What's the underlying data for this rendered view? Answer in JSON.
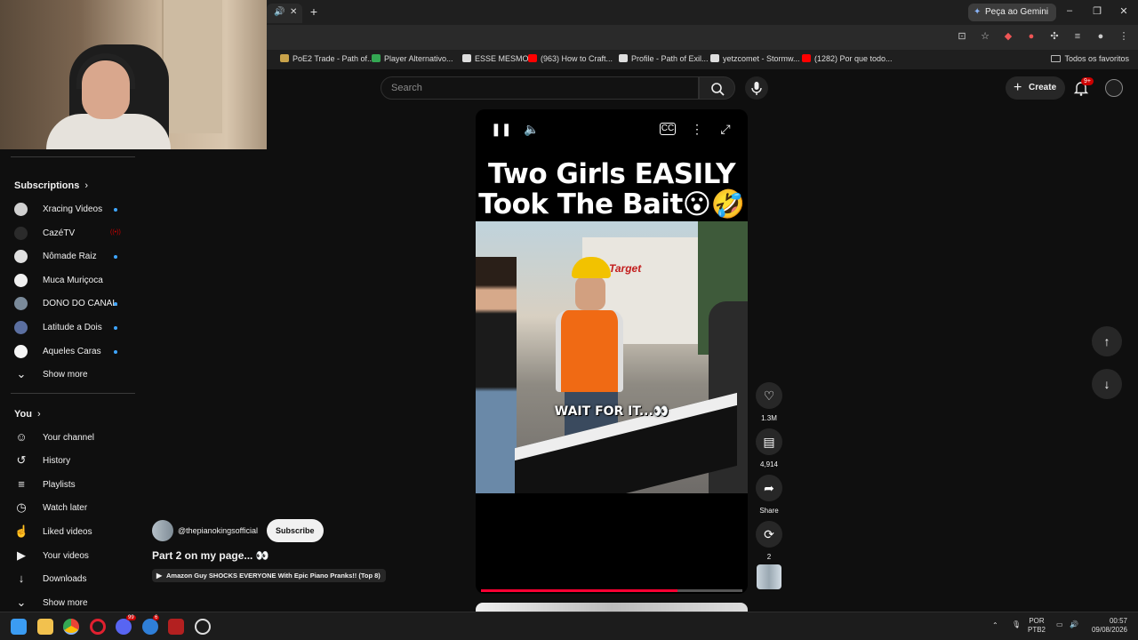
{
  "browser": {
    "gemini_label": "Peça ao Gemini",
    "bookmarks": [
      {
        "label": "PoE2 Trade - Path of...",
        "color": "#c8a24a"
      },
      {
        "label": "Player Alternativo...",
        "color": "#34a853"
      },
      {
        "label": "ESSE MESMO",
        "color": "#dddddd"
      },
      {
        "label": "(963) How to Craft...",
        "color": "#ff0000"
      },
      {
        "label": "Profile - Path of Exil...",
        "color": "#dddddd"
      },
      {
        "label": "yetzcomet - Stormw...",
        "color": "#dddddd"
      },
      {
        "label": "(1282) Por que todo...",
        "color": "#ff0000"
      }
    ],
    "all_favorites": "Todos os favoritos"
  },
  "youtube": {
    "search_placeholder": "Search",
    "create_label": "Create",
    "notifications_badge": "9+"
  },
  "sidebar": {
    "subscriptions_title": "Subscriptions",
    "subscriptions": [
      {
        "label": "Xracing Videos",
        "indicator": "dot",
        "color": "#d0d0d0"
      },
      {
        "label": "CazéTV",
        "indicator": "live",
        "color": "#2b2b2b"
      },
      {
        "label": "Nômade Raiz",
        "indicator": "dot",
        "color": "#e0e0e0"
      },
      {
        "label": "Muca Muriçoca",
        "indicator": "none",
        "color": "#f0f0f0"
      },
      {
        "label": "DONO DO CANAL",
        "indicator": "dot",
        "color": "#7a8a9a"
      },
      {
        "label": "Latitude a Dois",
        "indicator": "dot",
        "color": "#5b6fa0"
      },
      {
        "label": "Aqueles Caras",
        "indicator": "dot",
        "color": "#f5f5f5"
      }
    ],
    "show_more_1": "Show more",
    "you_title": "You",
    "you_items": [
      {
        "label": "Your channel",
        "icon": "person-icon",
        "glyph": "☺"
      },
      {
        "label": "History",
        "icon": "history-icon",
        "glyph": "↺"
      },
      {
        "label": "Playlists",
        "icon": "playlist-icon",
        "glyph": "≡"
      },
      {
        "label": "Watch later",
        "icon": "clock-icon",
        "glyph": "◷"
      },
      {
        "label": "Liked videos",
        "icon": "thumbs-up-icon",
        "glyph": "☝"
      },
      {
        "label": "Your videos",
        "icon": "video-icon",
        "glyph": "▶"
      },
      {
        "label": "Downloads",
        "icon": "download-icon",
        "glyph": "↓"
      }
    ],
    "show_more_2": "Show more"
  },
  "short": {
    "title_line1": "Two Girls EASILY",
    "title_line2": "Took The Bait😮🤣",
    "caption": "WAIT FOR IT...👀",
    "progress": 0.75,
    "channel": "@thepianokingsofficial",
    "subscribe_label": "Subscribe",
    "description": "Part 2 on my page... 👀",
    "link_chip": "Amazon Guy SHOCKS EVERYONE With Epic Piano Pranks!! (Top 8)",
    "likes": "1.3M",
    "comments": "4,914",
    "share_label": "Share",
    "remix_count": "2"
  },
  "taskbar": {
    "lang_line1": "POR",
    "lang_line2": "PTB2",
    "time": "00:57",
    "date": "09/08/2026",
    "badges": {
      "discord": "99",
      "edge": "6"
    }
  }
}
